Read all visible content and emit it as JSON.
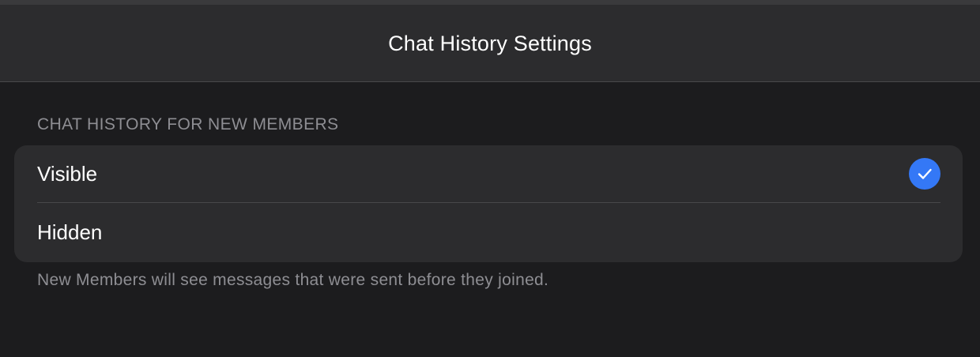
{
  "header": {
    "title": "Chat History Settings"
  },
  "section": {
    "title": "CHAT HISTORY FOR NEW MEMBERS",
    "options": [
      {
        "label": "Visible",
        "selected": true
      },
      {
        "label": "Hidden",
        "selected": false
      }
    ],
    "footer": "New Members will see messages that were sent before they joined."
  },
  "colors": {
    "background": "#1c1c1e",
    "header_background": "#2c2c2e",
    "group_background": "#2c2c2e",
    "accent": "#3478f6",
    "secondary_text": "#8e8e93",
    "separator": "#48484a"
  },
  "icons": {
    "selected_marker": "checkmark-circle-icon"
  }
}
